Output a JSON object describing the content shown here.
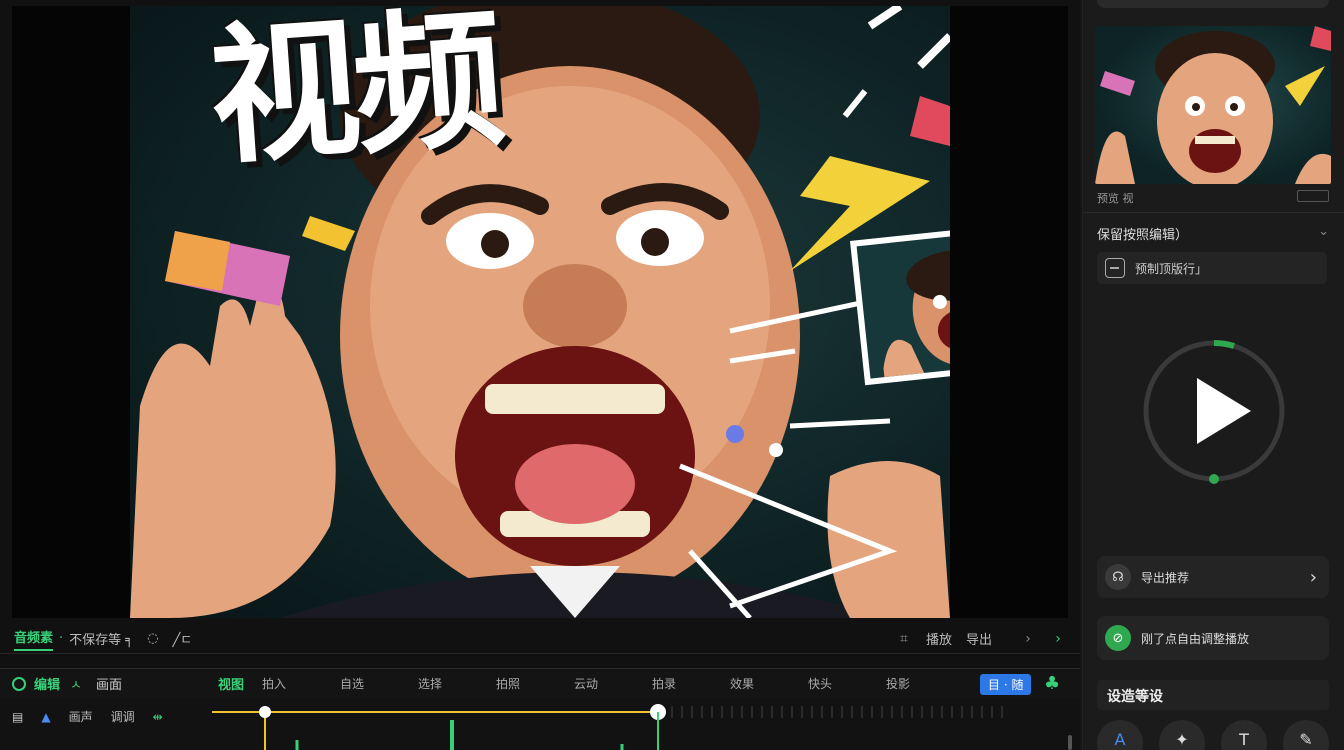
{
  "preview": {
    "overlay_title": "视频"
  },
  "toolbar": {
    "active_tab": "音频素",
    "items": [
      "不保存等 ╕",
      "◌",
      "╱ㄷ"
    ],
    "right_label": "播放",
    "right_label2": "导出"
  },
  "timeline": {
    "track_title": "编辑",
    "track_sub": "画面",
    "green_label": "视图",
    "ticks": [
      "拍入",
      "自选",
      "选择",
      "拍照",
      "云动",
      "拍录",
      "效果",
      "快头",
      "投影"
    ],
    "badge": "目 · 随",
    "row_labels": [
      "画声",
      "调调"
    ]
  },
  "right_panel": {
    "meta_left": "预览 视",
    "section_title": "保留按照编辑）",
    "field_text": "预制顶版行」",
    "row_buttons": [
      {
        "label": "导出推荐",
        "icon": "headset-icon",
        "color": "#3a3a3a"
      },
      {
        "label": "刚了点自由调整播放",
        "icon": "link-icon",
        "color": "#2fa84f"
      }
    ],
    "section2_title": "设造等设",
    "round_icons": [
      "A",
      "✦",
      "T",
      "✎"
    ]
  },
  "colors": {
    "accent_green": "#3ad07a",
    "accent_blue": "#2c78e6",
    "playhead_yellow": "#f2c230"
  }
}
